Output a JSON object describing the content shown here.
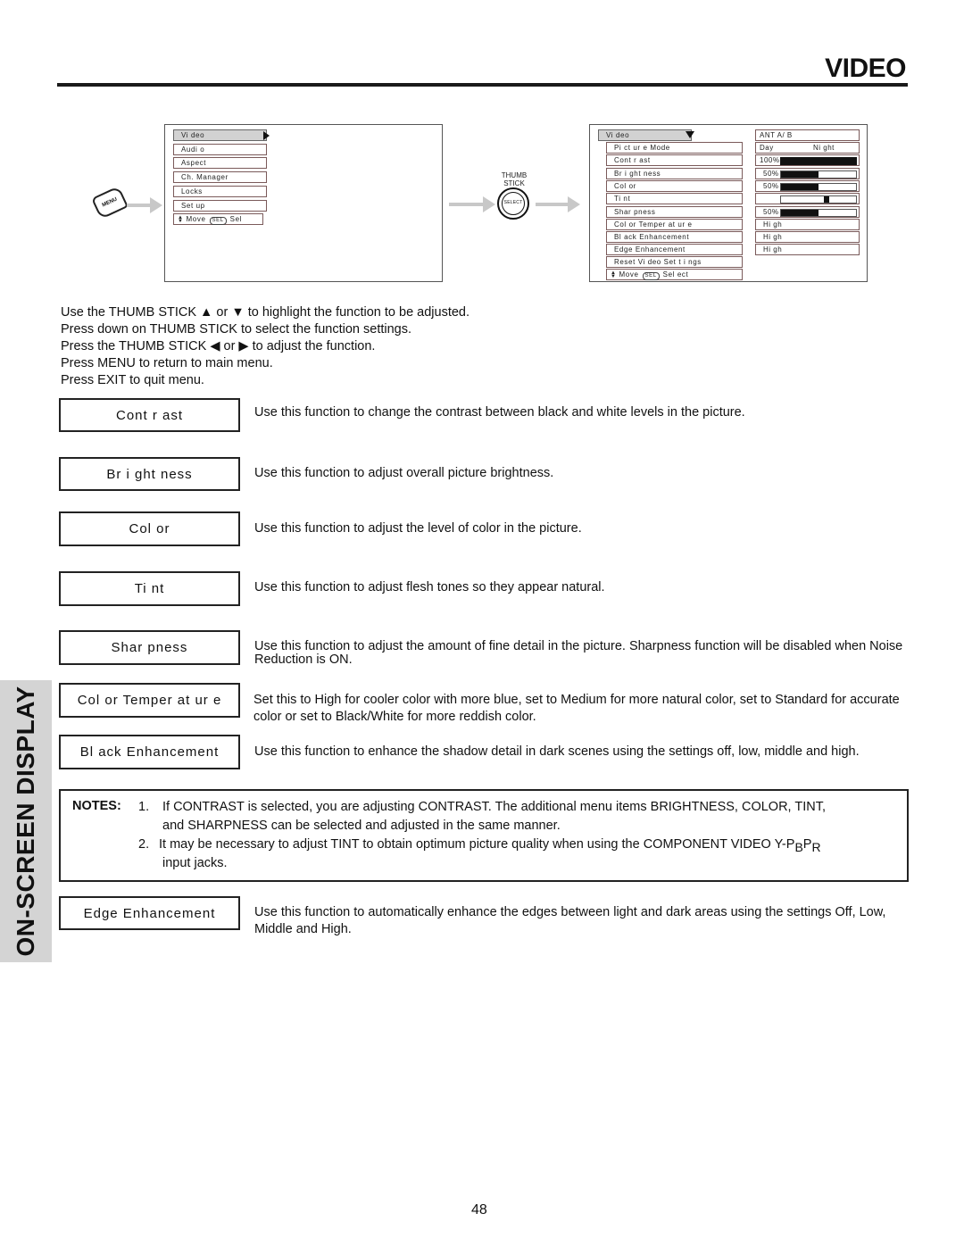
{
  "header": {
    "title": "VIDEO",
    "side_tab": "ON-SCREEN DISPLAY"
  },
  "main_menu": {
    "items": [
      "Vi deo",
      "Audi o",
      "Aspect",
      "Ch.  Manager",
      "Locks",
      "Set up"
    ],
    "footer": {
      "move": "Move",
      "sel_badge": "SEL",
      "sel": "Sel"
    },
    "menu_button_label": "MENU"
  },
  "thumb_stick": {
    "label_line1": "THUMB",
    "label_line2": "STICK",
    "button_label": "SELECT"
  },
  "video_menu": {
    "title": "Vi deo",
    "items": [
      "Pi ct ur e  Mode",
      "Cont r ast",
      "Br i ght ness",
      "Col or",
      "Ti nt",
      "Shar pness",
      "Col or  Temper at ur e",
      "Bl ack  Enhancement",
      "Edge  Enhancement",
      "Reset  Vi deo  Set t i ngs"
    ],
    "footer": {
      "move": "Move",
      "sel_badge": "SEL",
      "sel": "Sel ect"
    },
    "values": {
      "input": "ANT  A/ B",
      "picture_mode_left": "Day",
      "picture_mode_right": "Ni ght",
      "contrast_label": "100%",
      "contrast_level": 1.0,
      "brightness_label": "50%",
      "brightness_level": 0.5,
      "color_label": "50%",
      "color_level": 0.5,
      "tint_level": 0.5,
      "sharpness_label": "50%",
      "sharpness_level": 0.5,
      "color_temperature": "Hi gh",
      "black_enhancement": "Hi gh",
      "edge_enhancement": "Hi gh"
    }
  },
  "instructions": [
    "Use the THUMB STICK ▲ or ▼ to highlight the function to be adjusted.",
    "Press down on THUMB STICK to select the function settings.",
    "Press the THUMB STICK ◀ or ▶ to adjust the function.",
    "Press MENU to return to main menu.",
    "Press EXIT to quit menu."
  ],
  "functions": [
    {
      "name": "Cont r ast",
      "desc": "Use this function to change the contrast between black and white levels in the picture."
    },
    {
      "name": "Br i ght ness",
      "desc": "Use this function to adjust overall picture brightness."
    },
    {
      "name": "Col or",
      "desc": "Use this function to adjust the level of color in the picture."
    },
    {
      "name": "Ti nt",
      "desc": "Use this function to adjust flesh tones so they appear natural."
    },
    {
      "name": "Shar pness",
      "desc": "Use this function to adjust the amount of fine detail in the picture.  Sharpness function will be disabled when Noise Reduction is ON."
    },
    {
      "name": "Col or  Temper at ur e",
      "desc": "Set this to High for cooler color with more blue, set to Medium for more natural color, set to Standard for accurate color or set to Black/White for more reddish color."
    },
    {
      "name": "Bl ack  Enhancement",
      "desc": "Use this function to enhance the shadow detail in dark scenes using the settings off, low, middle and high."
    },
    {
      "name": "Edge  Enhancement",
      "desc": "Use this function to automatically enhance the edges between light and dark areas using the settings Off, Low, Middle and High."
    }
  ],
  "notes": {
    "label": "NOTES:",
    "n1_num": "1.",
    "n1_line1": "If CONTRAST is selected, you are adjusting CONTRAST.  The additional menu items BRIGHTNESS, COLOR, TINT,",
    "n1_line2": "and SHARPNESS can be selected and adjusted in the same manner.",
    "n2_num": "2.",
    "n2_line1": "It may be necessary to adjust TINT to obtain optimum picture quality when using the COMPONENT VIDEO Y-P",
    "n2_sub_b": "B",
    "n2_p": "P",
    "n2_sub_r": "R",
    "n2_line2": "input jacks."
  },
  "page_number": "48"
}
